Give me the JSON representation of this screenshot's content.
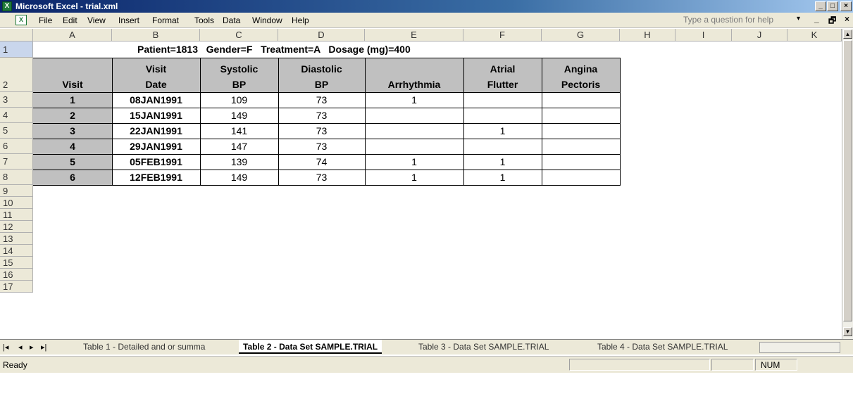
{
  "window": {
    "title": "Microsoft Excel - trial.xml",
    "minimize": "_",
    "maximize": "□",
    "close": "×"
  },
  "menu": {
    "items": [
      "File",
      "Edit",
      "View",
      "Insert",
      "Format",
      "Tools",
      "Data",
      "Window",
      "Help"
    ],
    "help_placeholder": "Type a question for help",
    "dropdown": "▾",
    "mdi_minimize": "_",
    "mdi_restore": "🗗",
    "mdi_close": "×"
  },
  "columns": [
    "A",
    "B",
    "C",
    "D",
    "E",
    "F",
    "G",
    "H",
    "I",
    "J",
    "K"
  ],
  "rows": [
    "1",
    "2",
    "3",
    "4",
    "5",
    "6",
    "7",
    "8",
    "9",
    "10",
    "11",
    "12",
    "13",
    "14",
    "15",
    "16",
    "17"
  ],
  "sheet": {
    "header_line": "Patient=1813   Gender=F   Treatment=A   Dosage (mg)=400",
    "headers": {
      "visit": "Visit",
      "visit_date_1": "Visit",
      "visit_date_2": "Date",
      "systolic_1": "Systolic",
      "systolic_2": "BP",
      "diastolic_1": "Diastolic",
      "diastolic_2": "BP",
      "arrhythmia": "Arrhythmia",
      "atrial_1": "Atrial",
      "atrial_2": "Flutter",
      "angina_1": "Angina",
      "angina_2": "Pectoris"
    },
    "data": [
      {
        "visit": "1",
        "date": "08JAN1991",
        "sys": "109",
        "dia": "73",
        "arr": "1",
        "af": "",
        "ang": ""
      },
      {
        "visit": "2",
        "date": "15JAN1991",
        "sys": "149",
        "dia": "73",
        "arr": "",
        "af": "",
        "ang": ""
      },
      {
        "visit": "3",
        "date": "22JAN1991",
        "sys": "141",
        "dia": "73",
        "arr": "",
        "af": "1",
        "ang": ""
      },
      {
        "visit": "4",
        "date": "29JAN1991",
        "sys": "147",
        "dia": "73",
        "arr": "",
        "af": "",
        "ang": ""
      },
      {
        "visit": "5",
        "date": "05FEB1991",
        "sys": "139",
        "dia": "74",
        "arr": "1",
        "af": "1",
        "ang": ""
      },
      {
        "visit": "6",
        "date": "12FEB1991",
        "sys": "149",
        "dia": "73",
        "arr": "1",
        "af": "1",
        "ang": ""
      }
    ]
  },
  "tabs": {
    "nav": [
      "|◂",
      "◂",
      "▸",
      "▸|"
    ],
    "items": [
      "Table 1 - Detailed and or summa",
      "Table 2 - Data Set SAMPLE.TRIAL",
      "Table 3 - Data Set SAMPLE.TRIAL",
      "Table 4 - Data Set SAMPLE.TRIAL"
    ]
  },
  "status": {
    "ready": "Ready",
    "num": "NUM"
  }
}
